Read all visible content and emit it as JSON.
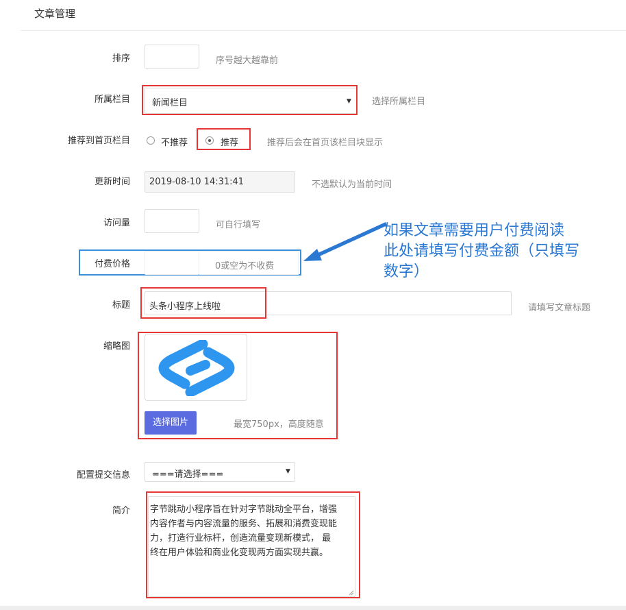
{
  "page": {
    "title": "文章管理"
  },
  "form": {
    "sort": {
      "label": "排序",
      "value": "",
      "hint": "序号越大越靠前"
    },
    "category": {
      "label": "所属栏目",
      "selected": "新闻栏目",
      "hint": "选择所属栏目"
    },
    "recommend": {
      "label": "推荐到首页栏目",
      "options": [
        "不推荐",
        "推荐"
      ],
      "selected": "推荐",
      "hint": "推荐后会在首页该栏目块显示"
    },
    "update_time": {
      "label": "更新时间",
      "value": "2019-08-10 14:31:41",
      "hint": "不选默认为当前时间"
    },
    "views": {
      "label": "访问量",
      "value": "",
      "hint": "可自行填写"
    },
    "price": {
      "label": "付费价格",
      "value": "",
      "placeholder": "0或空为不收费"
    },
    "title": {
      "label": "标题",
      "value": "头条小程序上线啦",
      "hint": "请填写文章标题"
    },
    "thumbnail": {
      "label": "缩略图",
      "button": "选择图片",
      "hint": "最宽750px，高度随意"
    },
    "submit_config": {
      "label": "配置提交信息",
      "selected": "===请选择==="
    },
    "intro": {
      "label": "简介",
      "value": "字节跳动小程序旨在针对字节跳动全平台，增强\n内容作者与内容流量的服务、拓展和消费变现能\n力，打造行业标杆，创造流量变现新模式， 最\n终在用户体验和商业化变现两方面实现共赢。"
    }
  },
  "annotation": {
    "text_lines": [
      "如果文章需要用户付费阅读",
      "此处请填写付费金额（只填写",
      "数字）"
    ]
  },
  "colors": {
    "highlight_red": "#e63535",
    "highlight_blue": "#3a8fd8",
    "button": "#5b6be0",
    "annotation": "#2a78d2",
    "logo": "#2f96f0"
  }
}
